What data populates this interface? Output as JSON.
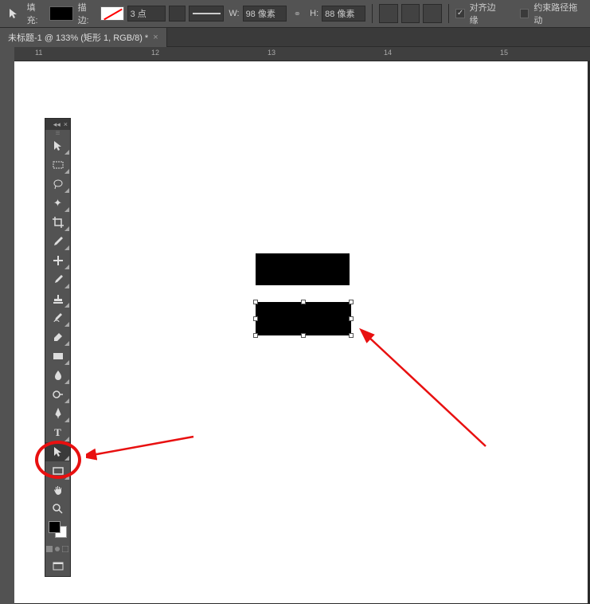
{
  "options_bar": {
    "fill_label": "填充:",
    "stroke_label": "描边:",
    "stroke_weight": "3 点",
    "w_label": "W:",
    "w_value": "98 像素",
    "h_label": "H:",
    "h_value": "88 像素",
    "align_edges_label": "对齐边缘",
    "align_edges_checked": true,
    "constrain_path_drag_label": "约束路径拖动",
    "constrain_checked": false
  },
  "tab": {
    "title": "未标题-1 @ 133% (矩形 1, RGB/8) *"
  },
  "ruler": {
    "marks": [
      "11",
      "12",
      "13",
      "14",
      "15"
    ]
  },
  "tools": [
    {
      "name": "move",
      "glyph": "↖"
    },
    {
      "name": "marquee",
      "glyph": "▭"
    },
    {
      "name": "lasso",
      "glyph": "◯"
    },
    {
      "name": "magic-wand",
      "glyph": "✦"
    },
    {
      "name": "crop",
      "glyph": "✂"
    },
    {
      "name": "eyedropper",
      "glyph": "✎"
    },
    {
      "name": "healing",
      "glyph": "✚"
    },
    {
      "name": "brush",
      "glyph": "✏"
    },
    {
      "name": "stamp",
      "glyph": "▲"
    },
    {
      "name": "history-brush",
      "glyph": "✑"
    },
    {
      "name": "eraser",
      "glyph": "▱"
    },
    {
      "name": "gradient",
      "glyph": "■"
    },
    {
      "name": "blur",
      "glyph": "◉"
    },
    {
      "name": "dodge",
      "glyph": "◐"
    },
    {
      "name": "pen",
      "glyph": "✒"
    },
    {
      "name": "type",
      "glyph": "T"
    },
    {
      "name": "path-select",
      "glyph": "↖"
    },
    {
      "name": "rectangle",
      "glyph": "▭"
    },
    {
      "name": "hand",
      "glyph": "✋"
    },
    {
      "name": "zoom",
      "glyph": "🔍"
    }
  ]
}
